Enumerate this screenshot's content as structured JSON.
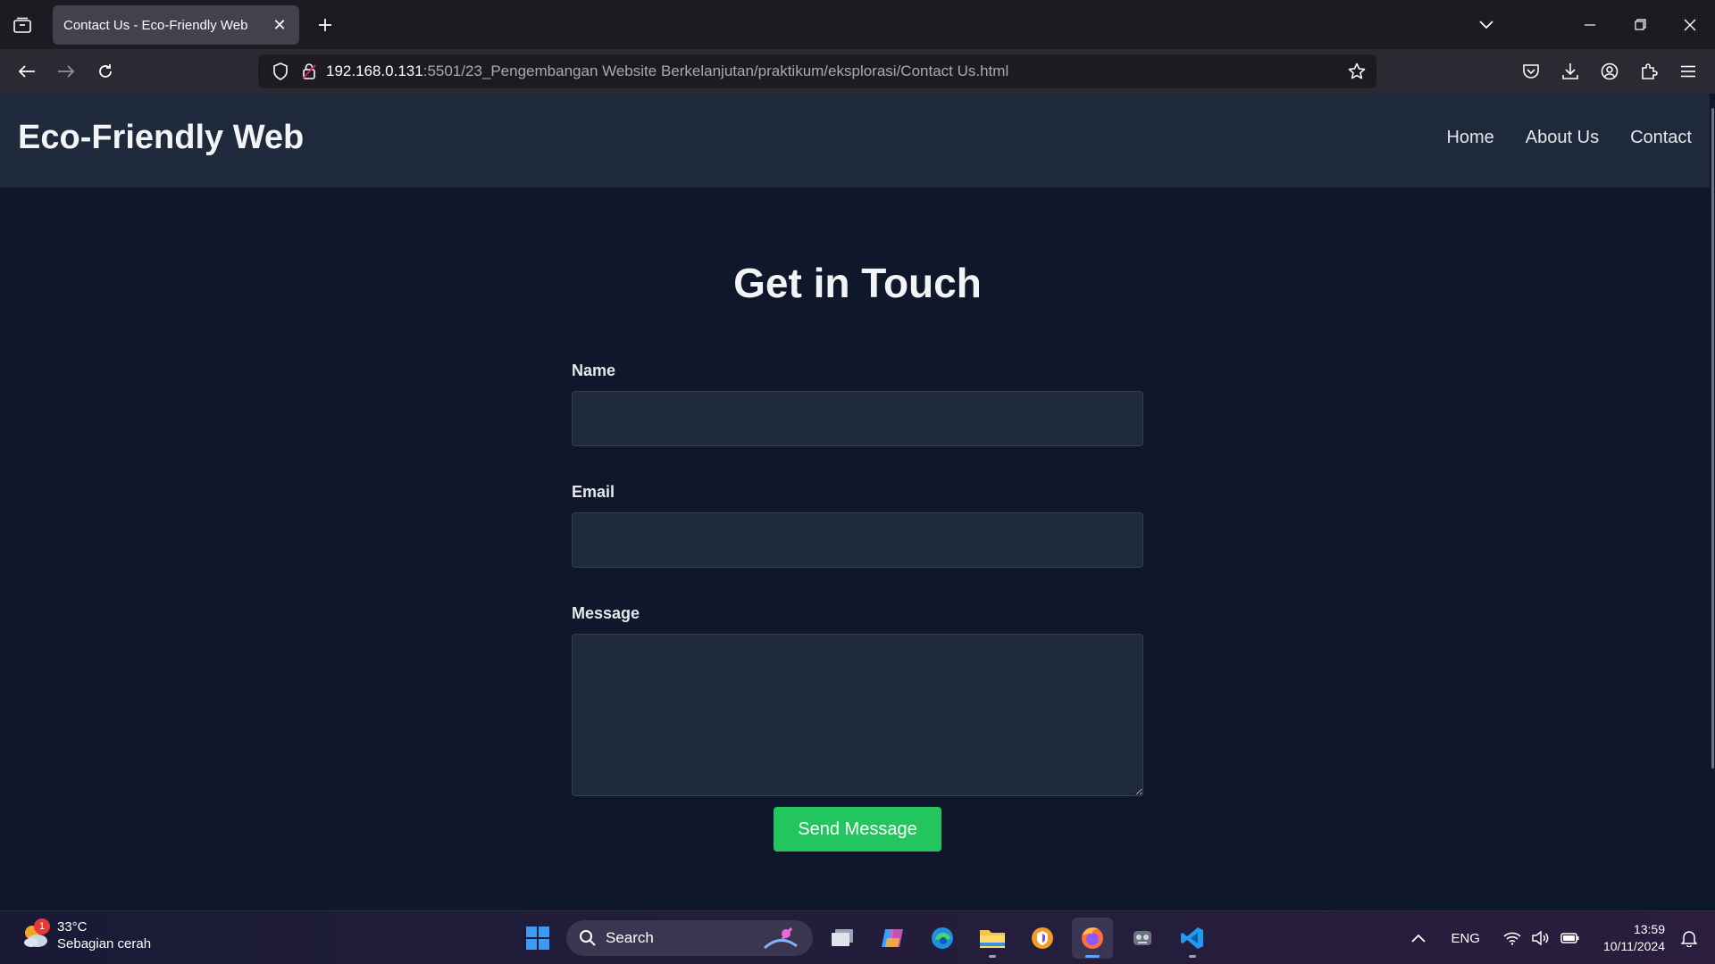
{
  "browser": {
    "tab_title": "Contact Us - Eco-Friendly Web",
    "url_host": "192.168.0.131",
    "url_path": ":5501/23_Pengembangan Website Berkelanjutan/praktikum/eksplorasi/Contact Us.html"
  },
  "site": {
    "logo": "Eco-Friendly Web",
    "nav": [
      "Home",
      "About Us",
      "Contact"
    ]
  },
  "contact": {
    "heading": "Get in Touch",
    "name_label": "Name",
    "email_label": "Email",
    "message_label": "Message",
    "submit_label": "Send Message"
  },
  "taskbar": {
    "weather_temp": "33°C",
    "weather_desc": "Sebagian cerah",
    "weather_badge": "1",
    "search_label": "Search",
    "language": "ENG",
    "time": "13:59",
    "date": "10/11/2024"
  },
  "colors": {
    "page_bg": "#0f172a",
    "header_bg": "#1e293b",
    "button": "#22c55e"
  }
}
